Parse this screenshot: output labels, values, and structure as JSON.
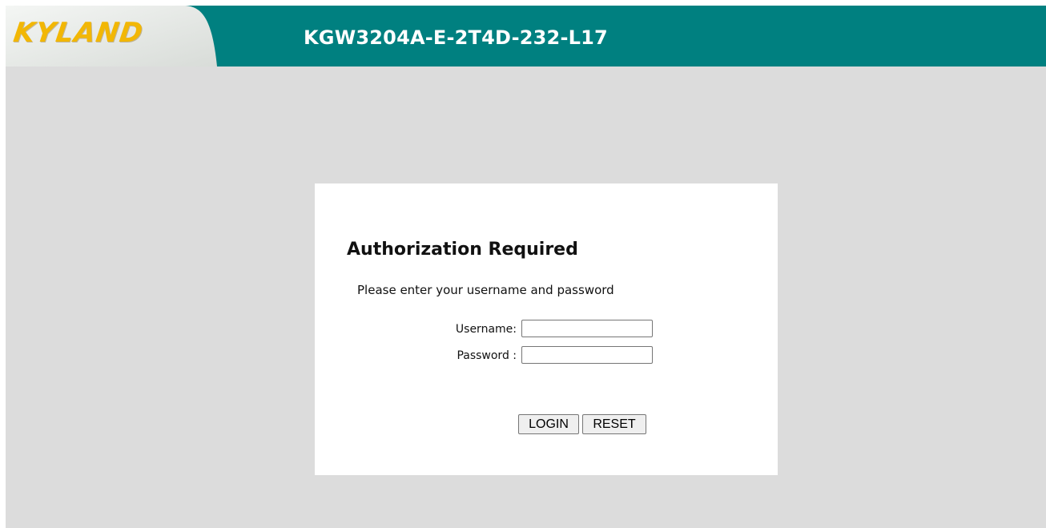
{
  "header": {
    "logo_text": "KYLAND",
    "device_title": "KGW3204A-E-2T4D-232-L17",
    "colors": {
      "bar": "#008080",
      "logo_text": "#f2b705",
      "logo_panel": "#e9ede9"
    }
  },
  "login": {
    "heading": "Authorization Required",
    "subtitle": "Please enter your username and password",
    "username_label": "Username:",
    "username_value": "",
    "password_label": "Password :",
    "password_value": "",
    "login_button": "LOGIN",
    "reset_button": "RESET"
  },
  "colors": {
    "page_background": "#dcdcdc",
    "card_background": "#ffffff"
  }
}
